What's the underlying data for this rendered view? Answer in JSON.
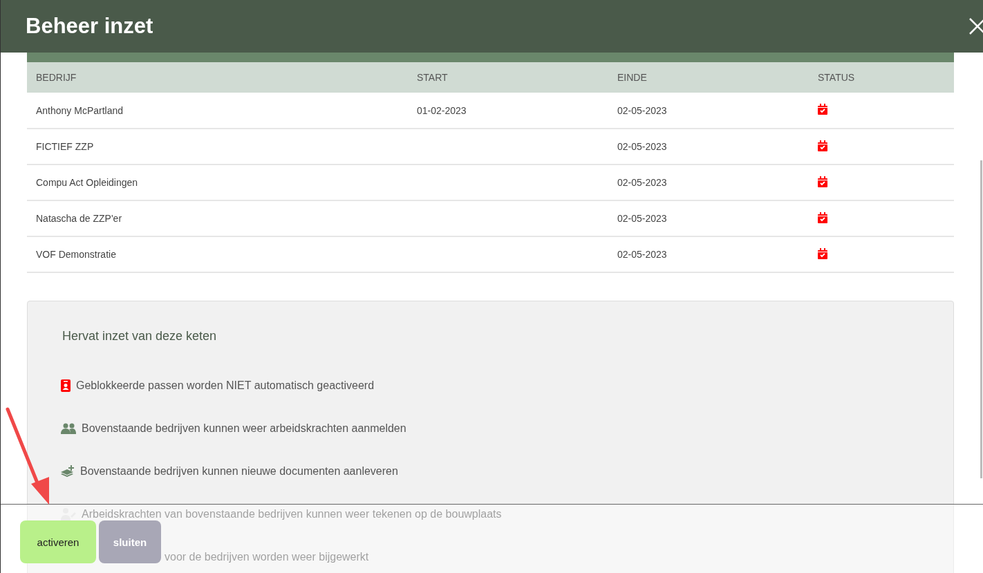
{
  "dialog": {
    "title": "Beheer inzet"
  },
  "table": {
    "columns": [
      "BEDRIJF",
      "START",
      "EINDE",
      "STATUS"
    ],
    "rows": [
      {
        "company": "Anthony McPartland",
        "start": "01-02-2023",
        "end": "02-05-2023"
      },
      {
        "company": "FICTIEF ZZP",
        "end": "02-05-2023"
      },
      {
        "company": "Compu Act Opleidingen",
        "end": "02-05-2023"
      },
      {
        "company": "Natascha de ZZP'er",
        "end": "02-05-2023"
      },
      {
        "company": "VOF Demonstratie",
        "end": "02-05-2023"
      }
    ]
  },
  "info_panel": {
    "title": "Hervat inzet van deze keten",
    "items": [
      {
        "kind": "badge",
        "text": "Geblokkeerde passen worden NIET automatisch geactiveerd"
      },
      {
        "kind": "users",
        "text": "Bovenstaande bedrijven kunnen weer arbeidskrachten aanmelden"
      },
      {
        "kind": "layers",
        "text": "Bovenstaande bedrijven kunnen nieuwe documenten aanleveren"
      },
      {
        "kind": "worker",
        "text": "Arbeidskrachten van bovenstaande bedrijven kunnen weer tekenen op de bouwplaats"
      },
      {
        "kind": "hidden",
        "text": "voor de bedrijven worden weer bijgewerkt"
      }
    ]
  },
  "footer": {
    "buttons": [
      {
        "kind": "primary",
        "label": "activeren"
      },
      {
        "kind": "secondary",
        "label": "sluiten"
      }
    ]
  }
}
